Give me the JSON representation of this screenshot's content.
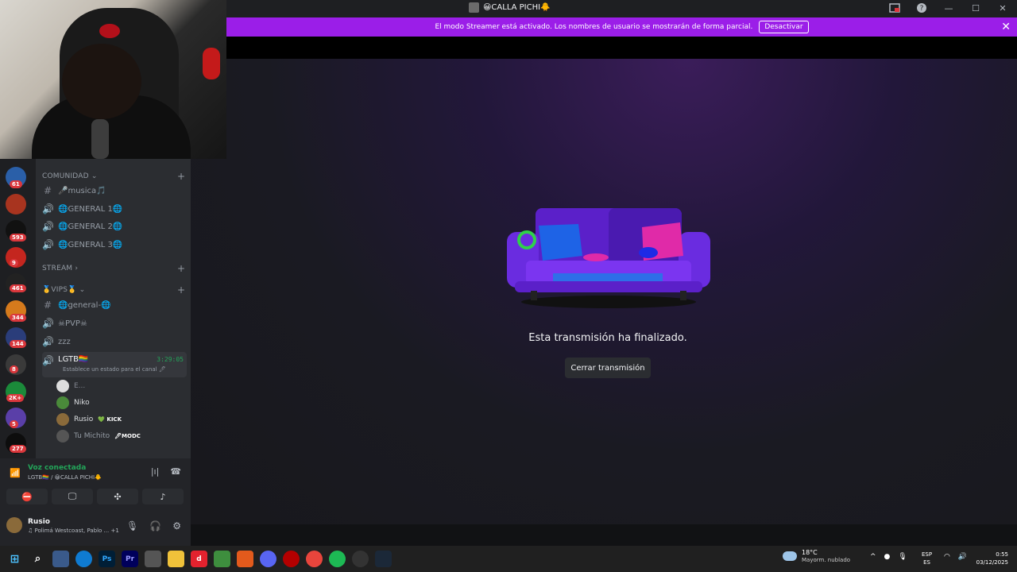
{
  "window": {
    "title": "😀CALLA PICHI🐥"
  },
  "banner": {
    "text": "El modo Streamer está activado. Los nombres de usuario se mostrarán de forma parcial.",
    "button": "Desactivar"
  },
  "server_badges": [
    "61",
    "593",
    "9",
    "461",
    "344",
    "144",
    "8",
    "2K+",
    "5",
    "277"
  ],
  "channels": {
    "category_comunidad": "COMUNIDAD",
    "musica": "🎤musica🎵",
    "general1": "🌐GENERAL 1🌐",
    "general2": "🌐GENERAL 2🌐",
    "general3": "🌐GENERAL 3🌐",
    "category_stream": "STREAM",
    "category_vips": "🥇VIPS🥇",
    "general_vip": "🌐general-🌐",
    "pvp": "☠PVP☠",
    "zzz": "zzz",
    "lgtb": "LGTB🏳‍🌈",
    "lgtb_timer": "3:29:05",
    "lgtb_status": "Establece un estado para el canal 🖊"
  },
  "voice_users": [
    {
      "name": "E...",
      "tag": ""
    },
    {
      "name": "Niko",
      "tag": ""
    },
    {
      "name": "Rusio",
      "tag": "💚 KICK"
    },
    {
      "name": "Tu Michito",
      "tag": "🖊MODC"
    }
  ],
  "voice_panel": {
    "status": "Voz conectada",
    "location": "LGTB🏳‍🌈 / 😀CALLA PICHI🐥"
  },
  "user_panel": {
    "name": "Rusio",
    "status": "♫ Polimá Westcoast, Pablo ...",
    "extra": "+1"
  },
  "stage": {
    "message": "Esta transmisión ha finalizado.",
    "close_button": "Cerrar transmisión"
  },
  "taskbar": {
    "temp": "18°C",
    "weather": "Mayorm. nublado",
    "lang1": "ESP",
    "lang2": "ES",
    "time": "0:55",
    "date": "03/12/2025"
  }
}
